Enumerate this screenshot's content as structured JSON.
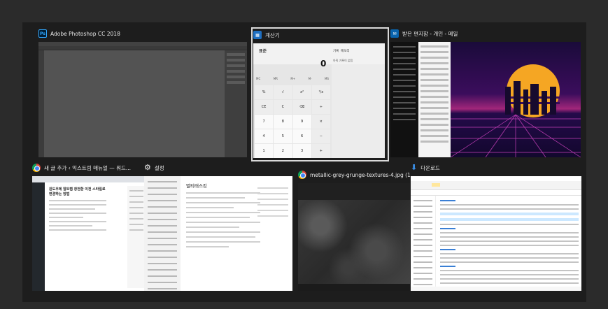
{
  "task_view": {
    "windows": [
      {
        "title": "Adobe Photoshop CC 2018",
        "icon": "photoshop-icon",
        "icon_text": "Ps"
      },
      {
        "title": "계산기",
        "icon": "calculator-icon",
        "selected": true,
        "content": {
          "mode": "표준",
          "display": "0",
          "history_tab": "기록",
          "memory_tab": "메모리",
          "history_empty": "아직 기록이 없음",
          "memory_keys": [
            "MC",
            "MR",
            "M+",
            "M-",
            "MS"
          ],
          "keys": [
            "%",
            "√",
            "x²",
            "¹/x",
            "CE",
            "C",
            "⌫",
            "÷",
            "7",
            "8",
            "9",
            "×",
            "4",
            "5",
            "6",
            "−",
            "1",
            "2",
            "3",
            "+",
            "±",
            "0",
            ".",
            "="
          ]
        }
      },
      {
        "title": "받은 편지함 - 개인 - 메일",
        "icon": "mail-icon"
      },
      {
        "title": "새 글 추가 ‹ 익스트림 매뉴얼 — 워드...",
        "icon": "chrome-icon",
        "content": {
          "heading": "윈도우에 알트탭 창전환 이전 스타일로 변경하는 방법"
        }
      },
      {
        "title": "설정",
        "icon": "gear-icon",
        "content": {
          "heading": "멀티태스킹"
        }
      },
      {
        "title": "metallic-grey-grunge-textures-4.jpg (1...",
        "icon": "chrome-icon"
      },
      {
        "title": "다운로드",
        "icon": "download-icon"
      }
    ]
  },
  "colors": {
    "background": "#2b2b2b",
    "panel": "#1d1d1d",
    "selection": "#d9d9d9"
  }
}
